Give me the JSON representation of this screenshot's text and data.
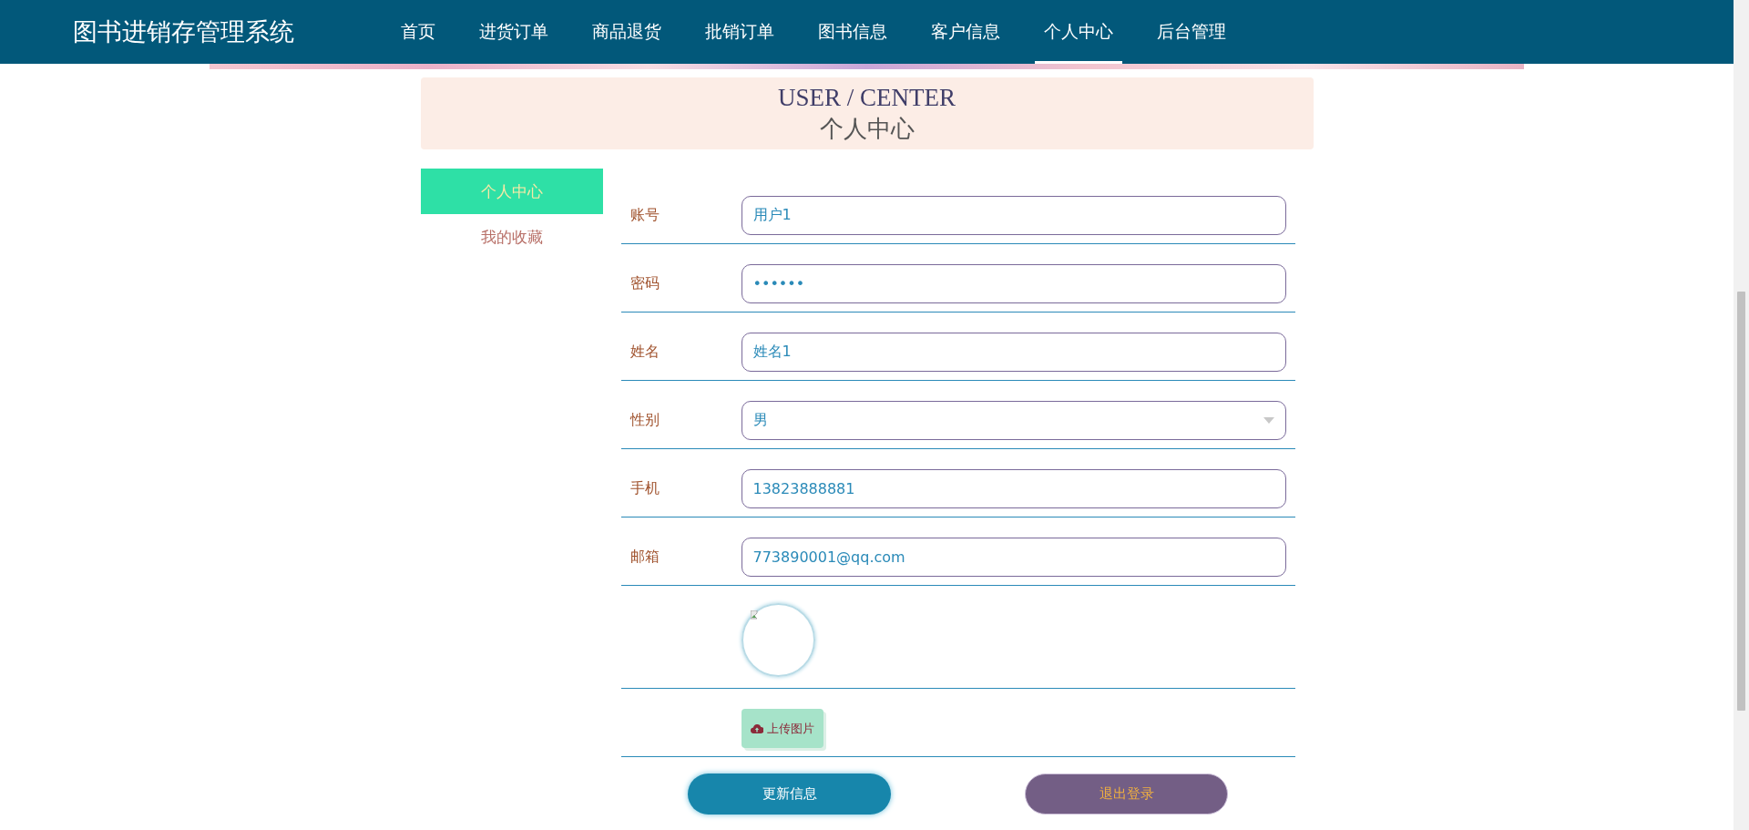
{
  "header": {
    "title": "图书进销存管理系统",
    "nav": [
      {
        "label": "首页",
        "selected": false
      },
      {
        "label": "进货订单",
        "selected": false
      },
      {
        "label": "商品退货",
        "selected": false
      },
      {
        "label": "批销订单",
        "selected": false
      },
      {
        "label": "图书信息",
        "selected": false
      },
      {
        "label": "客户信息",
        "selected": false
      },
      {
        "label": "个人中心",
        "selected": true
      },
      {
        "label": "后台管理",
        "selected": false
      }
    ]
  },
  "banner": {
    "title": "USER / CENTER",
    "subtitle": "个人中心"
  },
  "sidebar": {
    "items": [
      {
        "label": "个人中心",
        "selected": true
      },
      {
        "label": "我的收藏",
        "selected": false
      }
    ]
  },
  "form": {
    "rows": [
      {
        "kind": "text",
        "label": "账号",
        "value": "用户1"
      },
      {
        "kind": "text",
        "label": "密码",
        "value": "••••••"
      },
      {
        "kind": "text",
        "label": "姓名",
        "value": "姓名1"
      },
      {
        "kind": "select",
        "label": "性别",
        "value": "男"
      },
      {
        "kind": "text",
        "label": "手机",
        "value": "13823888881"
      },
      {
        "kind": "text",
        "label": "邮箱",
        "value": "773890001@qq.com"
      },
      {
        "kind": "avatar"
      },
      {
        "kind": "upload",
        "button": "上传图片"
      }
    ]
  },
  "actions": [
    {
      "kind": "primary",
      "label": "更新信息"
    },
    {
      "kind": "secondary",
      "label": "退出登录"
    }
  ]
}
